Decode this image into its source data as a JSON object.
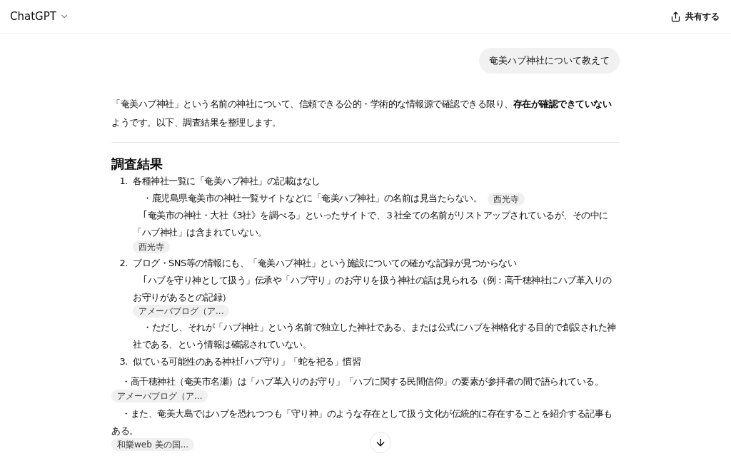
{
  "header": {
    "title": "ChatGPT",
    "share_label": "共有する"
  },
  "user_message": "奄美ハブ神社について教えて",
  "answer": {
    "intro": "「奄美ハブ神社」という名前の神社について、信頼できる公的・学術的な情報源で確認できる限り、**存在が確認できていない**ようです。以下、調査結果を整理します。",
    "heading": "調査結果",
    "items": [
      {
        "number": "1.",
        "title": "各種神社一覧に「奄美ハブ神社」の記載はなし",
        "lines": [
          {
            "text": "・鹿児島県奄美市の神社一覧サイトなどに「奄美ハブ神社」の名前は見当たらない。",
            "citation": "西光寺"
          },
          {
            "text": "｢奄美市の神社・大社《3社》を調べる」といったサイトで、３社全ての名前がリストアップされているが、その中に「ハブ神社」は含まれていない。",
            "citation": "西光寺"
          }
        ]
      },
      {
        "number": "2.",
        "title": "ブログ・SNS等の情報にも、「奄美ハブ神社」という施設についての確かな記録が見つからない",
        "lines": [
          {
            "text": "｢ハブを守り神として扱う」伝承や「ハブ守り」のお守りを扱う神社の話は見られる（例：高千穂神社にハブ革入りのお守りがあるとの記録）",
            "citation": "アメーバブログ（ア..."
          },
          {
            "text": "・ただし、それが「ハブ神社」という名前で独立した神社である、または公式にハブを神格化する目的で創設された神社である、という情報は確認されていない。"
          }
        ]
      },
      {
        "number": "3.",
        "title": "似ている可能性のある神社｢ハブ守り」「蛇を祀る」慣習"
      }
    ],
    "paragraphs": [
      {
        "text": "・高千穂神社（奄美市名瀬）は「ハブ革入りのお守り」「ハブに関する民間信仰」の要素が参拝者の間で語られている。",
        "citation": "アメーバブログ（ア..."
      },
      {
        "text": "・また、奄美大島ではハブを恐れつつも「守り神」のような存在として扱う文化が伝統的に存在することを紹介する記事もある。",
        "citation": "和樂web 美の国..."
      }
    ]
  }
}
